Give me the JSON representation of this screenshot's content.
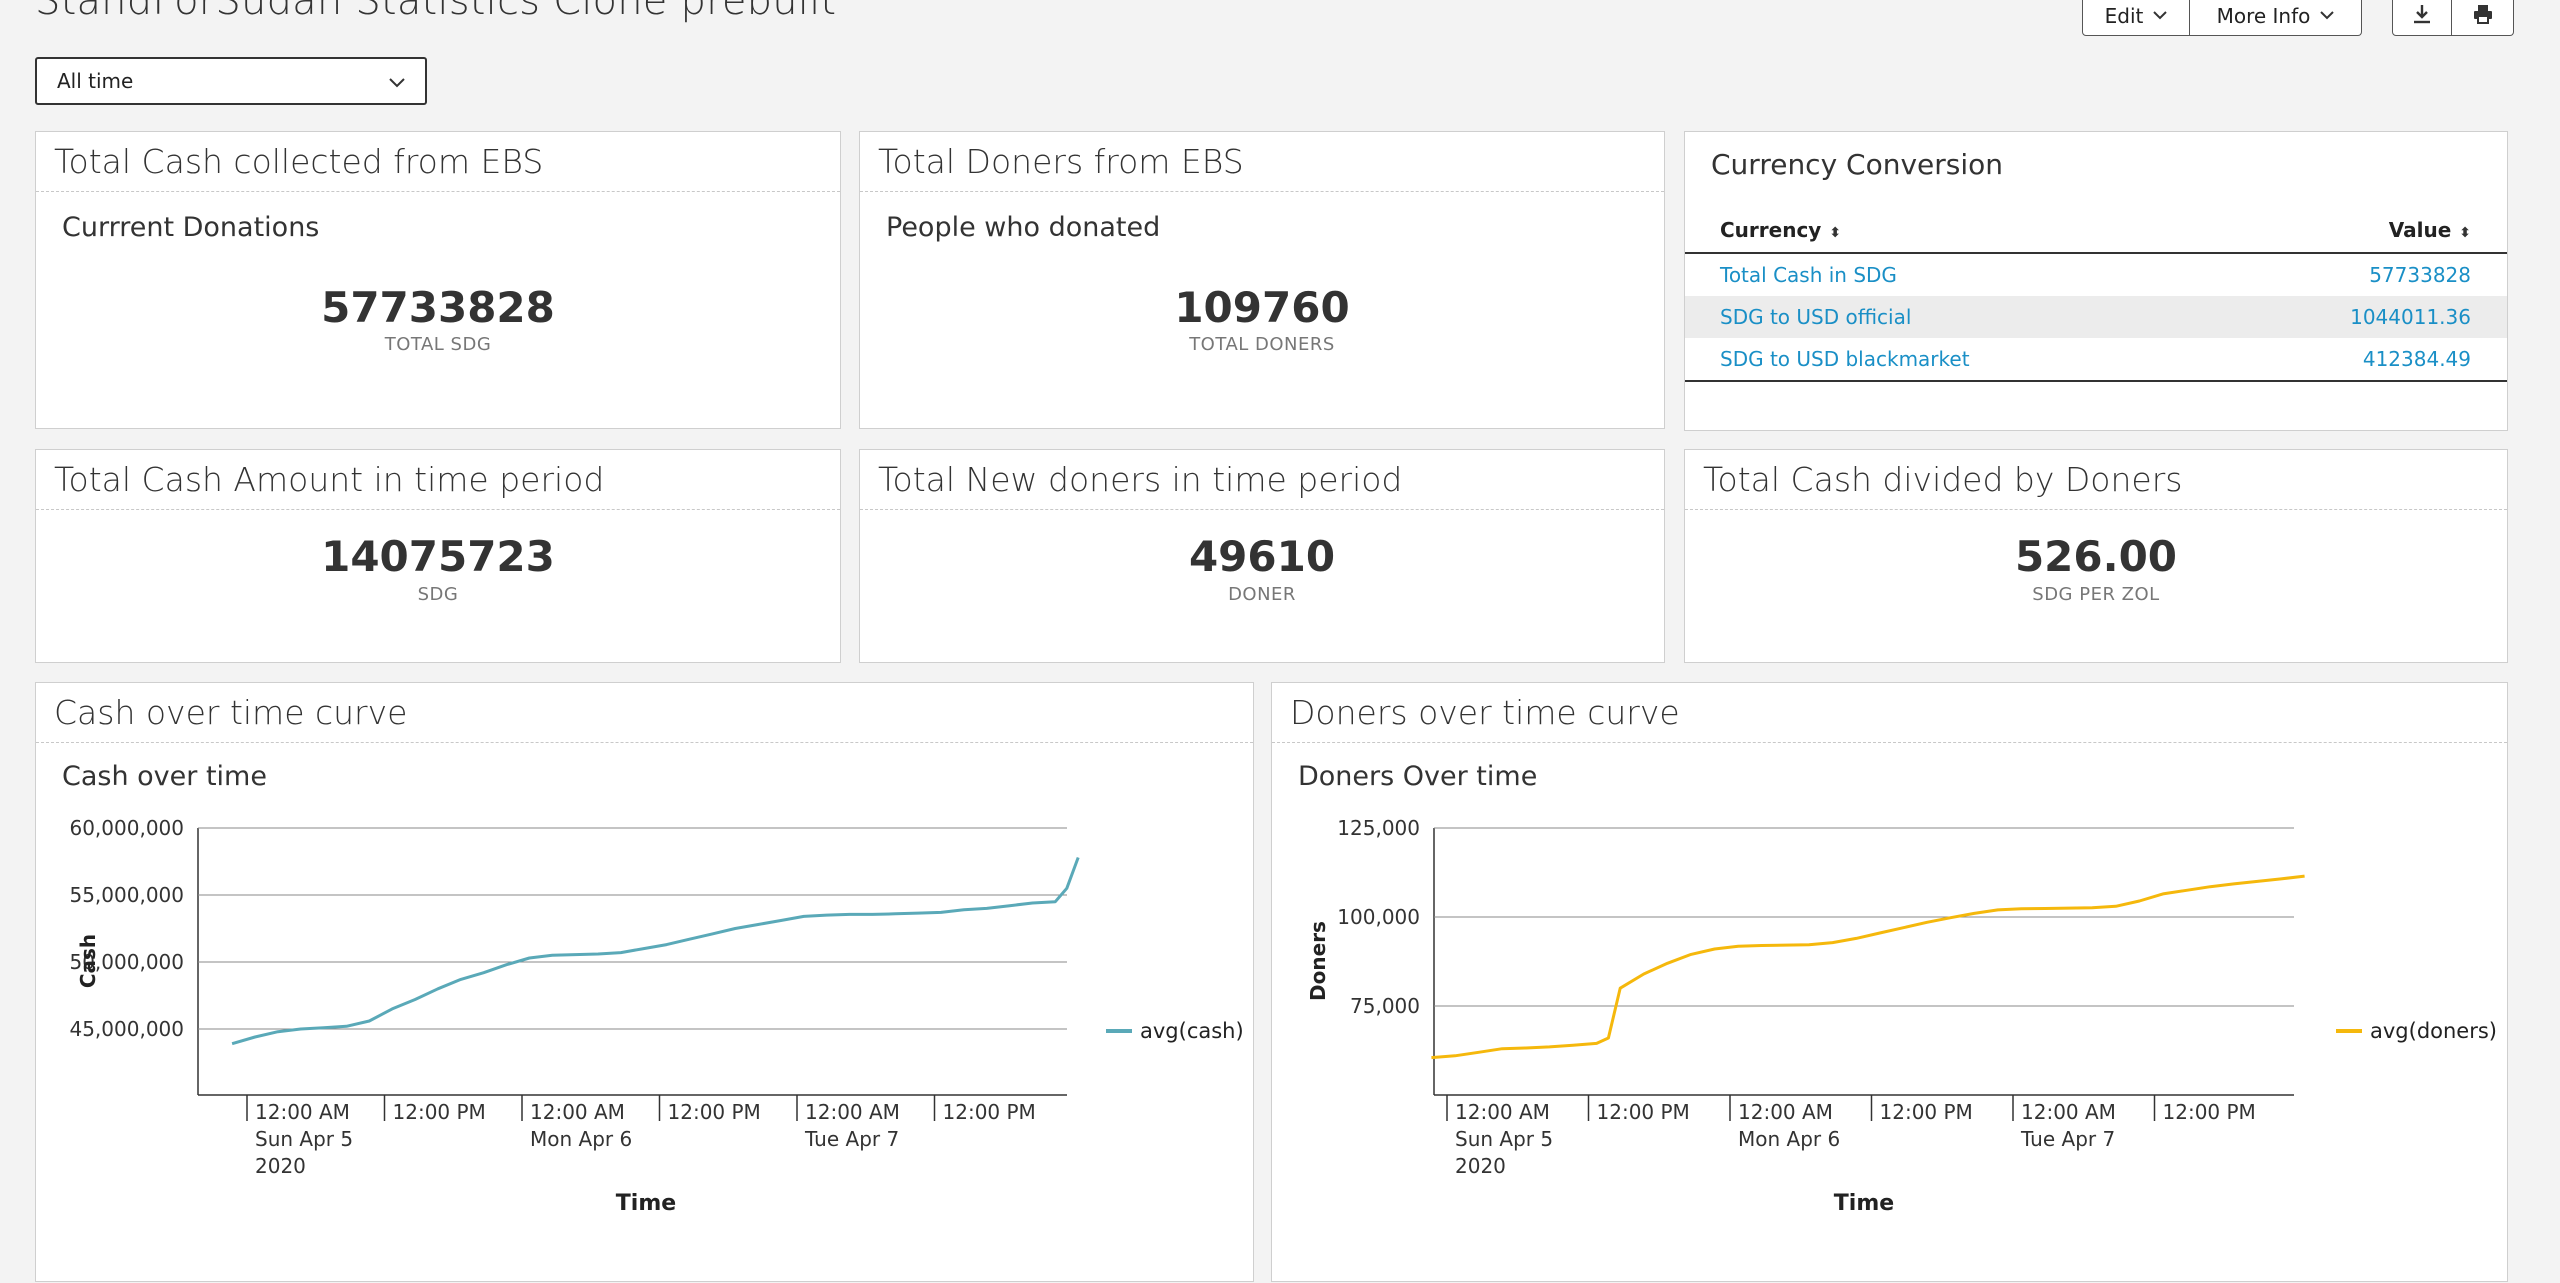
{
  "header": {
    "title": "StandForSudan Statistics Clone prebuilt",
    "edit_label": "Edit",
    "more_info_label": "More Info",
    "download_icon": "download-icon",
    "print_icon": "print-icon"
  },
  "filter": {
    "time_range": "All time"
  },
  "cards": {
    "total_cash": {
      "title": "Total Cash collected from EBS",
      "subtitle": "Currrent Donations",
      "value": "57733828",
      "unit": "TOTAL SDG"
    },
    "total_doners": {
      "title": "Total Doners from EBS",
      "subtitle": "People who donated",
      "value": "109760",
      "unit": "TOTAL DONERS"
    },
    "cash_period": {
      "title": "Total Cash Amount in time period",
      "value": "14075723",
      "unit": "SDG"
    },
    "new_doners": {
      "title": "Total New doners in time period",
      "value": "49610",
      "unit": "DONER"
    },
    "cash_per_doner": {
      "title": "Total Cash divided by Doners",
      "value": "526.00",
      "unit": "SDG PER ZOL"
    }
  },
  "currency": {
    "title": "Currency Conversion",
    "col_currency": "Currency",
    "col_value": "Value",
    "rows": [
      {
        "currency": "Total Cash in SDG",
        "value": "57733828"
      },
      {
        "currency": "SDG to USD official",
        "value": "1044011.36"
      },
      {
        "currency": "SDG to USD blackmarket",
        "value": "412384.49"
      }
    ]
  },
  "panels": {
    "cash": {
      "title": "Cash over time curve"
    },
    "doners": {
      "title": "Doners over time curve"
    }
  },
  "colors": {
    "cash_line": "#5aa9b8",
    "doners_line": "#f5b80c",
    "link": "#1a8fc6"
  },
  "chart_data": [
    {
      "type": "line",
      "title": "Cash over time",
      "xlabel": "Time",
      "ylabel": "Cash",
      "ylim": [
        40000000,
        62000000
      ],
      "yticks": [
        {
          "value": 45000000,
          "label": "45,000,000"
        },
        {
          "value": 50000000,
          "label": "50,000,000"
        },
        {
          "value": 55000000,
          "label": "55,000,000"
        },
        {
          "value": 60000000,
          "label": "60,000,000"
        }
      ],
      "xlim": [
        -10,
        51
      ],
      "xticks": [
        {
          "x": 0,
          "lines": [
            "12:00 AM",
            "Sun Apr 5",
            "2020"
          ]
        },
        {
          "x": 12,
          "lines": [
            "12:00 PM"
          ]
        },
        {
          "x": 24,
          "lines": [
            "12:00 AM",
            "Mon Apr 6"
          ]
        },
        {
          "x": 36,
          "lines": [
            "12:00 PM"
          ]
        },
        {
          "x": 48,
          "lines": [
            "12:00 AM",
            "Tue Apr 7"
          ]
        },
        {
          "x": 60,
          "lines": [
            "12:00 PM"
          ]
        }
      ],
      "grid": true,
      "legend": "right",
      "series": [
        {
          "name": "avg(cash)",
          "x": [
            -2,
            0,
            2,
            4,
            6,
            8,
            10,
            12,
            14,
            16,
            18,
            20,
            22,
            24,
            26,
            28,
            30,
            32,
            34,
            36,
            38,
            40,
            42,
            44,
            46,
            48,
            50,
            52,
            54,
            56,
            58,
            60,
            62,
            64,
            66,
            68,
            70,
            71,
            72
          ],
          "y": [
            43900000,
            44400000,
            44800000,
            45000000,
            45100000,
            45200000,
            45600000,
            46500000,
            47200000,
            48000000,
            48700000,
            49200000,
            49800000,
            50300000,
            50500000,
            50550000,
            50600000,
            50700000,
            51000000,
            51300000,
            51700000,
            52100000,
            52500000,
            52800000,
            53100000,
            53400000,
            53500000,
            53550000,
            53550000,
            53600000,
            53650000,
            53700000,
            53900000,
            54000000,
            54200000,
            54400000,
            54500000,
            55500000,
            57800000
          ]
        }
      ]
    },
    {
      "type": "line",
      "title": "Doners Over time",
      "xlabel": "Time",
      "ylabel": "Doners",
      "ylim": [
        50000,
        128000
      ],
      "yticks": [
        {
          "value": 75000,
          "label": "75,000"
        },
        {
          "value": 100000,
          "label": "100,000"
        },
        {
          "value": 125000,
          "label": "125,000"
        }
      ],
      "xlim": [
        -10,
        51
      ],
      "xticks": [
        {
          "x": 0,
          "lines": [
            "12:00 AM",
            "Sun Apr 5",
            "2020"
          ]
        },
        {
          "x": 12,
          "lines": [
            "12:00 PM"
          ]
        },
        {
          "x": 24,
          "lines": [
            "12:00 AM",
            "Mon Apr 6"
          ]
        },
        {
          "x": 36,
          "lines": [
            "12:00 PM"
          ]
        },
        {
          "x": 48,
          "lines": [
            "12:00 AM",
            "Tue Apr 7"
          ]
        },
        {
          "x": 60,
          "lines": [
            "12:00 PM"
          ]
        }
      ],
      "grid": true,
      "legend": "right",
      "series": [
        {
          "name": "avg(doners)",
          "x": [
            -2,
            0,
            2,
            4,
            6,
            8,
            10,
            12,
            13,
            14,
            16,
            18,
            20,
            22,
            24,
            26,
            28,
            30,
            32,
            34,
            36,
            38,
            40,
            42,
            44,
            46,
            48,
            50,
            52,
            54,
            56,
            58,
            60,
            62,
            64,
            66,
            68,
            70,
            72
          ],
          "y": [
            60500,
            61000,
            62000,
            63000,
            63200,
            63500,
            64000,
            64500,
            66000,
            80000,
            84000,
            87000,
            89500,
            91000,
            91800,
            92000,
            92100,
            92200,
            92800,
            94000,
            95500,
            97000,
            98500,
            99800,
            101000,
            102000,
            102300,
            102400,
            102500,
            102600,
            103000,
            104500,
            106500,
            107500,
            108500,
            109300,
            110000,
            110700,
            111500
          ]
        }
      ]
    }
  ]
}
